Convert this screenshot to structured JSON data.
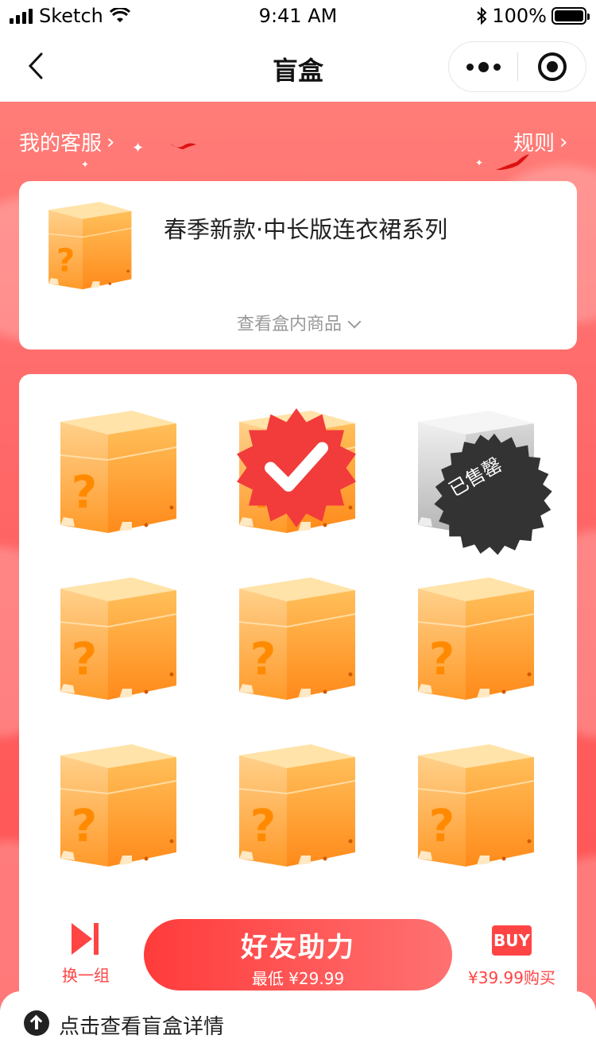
{
  "status_bar": {
    "carrier": "Sketch",
    "time": "9:41 AM",
    "battery": "100%"
  },
  "nav": {
    "title": "盲盒"
  },
  "header_links": {
    "customer_service": "我的客服",
    "rules": "规则"
  },
  "info_card": {
    "title": "春季新款·中长版连衣裙系列",
    "view_items": "查看盒内商品"
  },
  "boxes": [
    {
      "state": "available"
    },
    {
      "state": "selected"
    },
    {
      "state": "sold_out",
      "label": "已售罄"
    },
    {
      "state": "available"
    },
    {
      "state": "available"
    },
    {
      "state": "available"
    },
    {
      "state": "available"
    },
    {
      "state": "available"
    },
    {
      "state": "available"
    }
  ],
  "actions": {
    "switch_label": "换一组",
    "main_title": "好友助力",
    "main_subtitle": "最低 ¥29.99",
    "buy_badge": "BUY",
    "buy_label": "¥39.99购买"
  },
  "sheet": {
    "text": "点击查看盲盒详情"
  },
  "colors": {
    "accent": "#ff4444",
    "box_orange": "#ffa235",
    "sold_grey": "#bdbdbd"
  }
}
